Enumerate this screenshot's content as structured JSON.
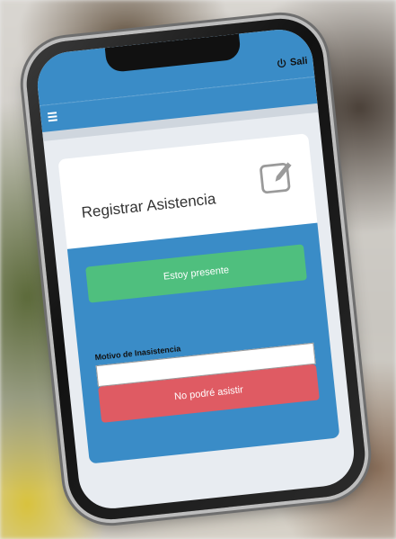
{
  "topbar": {
    "logout_label": "Sali"
  },
  "card": {
    "title": "Registrar Asistencia"
  },
  "actions": {
    "present_label": "Estoy presente",
    "absence_label": "Motivo de Inasistencia",
    "absence_value": "",
    "absent_label": "No podré asistir"
  },
  "colors": {
    "primary": "#3a8cc7",
    "success": "#4fbf7e",
    "danger": "#df5b63"
  },
  "icons": {
    "menu": "hamburger-menu-icon",
    "logout": "power-icon",
    "header": "edit-icon"
  }
}
